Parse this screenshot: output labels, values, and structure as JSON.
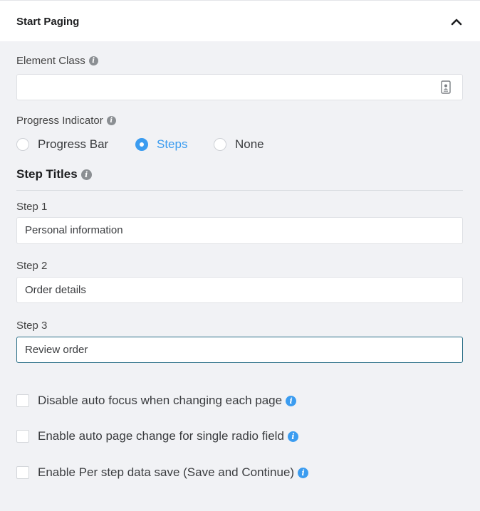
{
  "panel": {
    "title": "Start Paging",
    "collapse_icon": "chevron-up-icon"
  },
  "element_class": {
    "label": "Element Class",
    "value": "",
    "icon": "contacts-book-icon"
  },
  "progress_indicator": {
    "label": "Progress Indicator",
    "options": [
      {
        "label": "Progress Bar",
        "checked": false
      },
      {
        "label": "Steps",
        "checked": true
      },
      {
        "label": "None",
        "checked": false
      }
    ],
    "accent_color": "#3b9cf0"
  },
  "step_titles": {
    "title": "Step Titles",
    "steps": [
      {
        "label": "Step 1",
        "value": "Personal information"
      },
      {
        "label": "Step 2",
        "value": "Order details"
      },
      {
        "label": "Step 3",
        "value": "Review order"
      }
    ]
  },
  "options": [
    {
      "label": "Disable auto focus when changing each page",
      "checked": false
    },
    {
      "label": "Enable auto page change for single radio field",
      "checked": false
    },
    {
      "label": "Enable Per step data save (Save and Continue)",
      "checked": false
    }
  ]
}
